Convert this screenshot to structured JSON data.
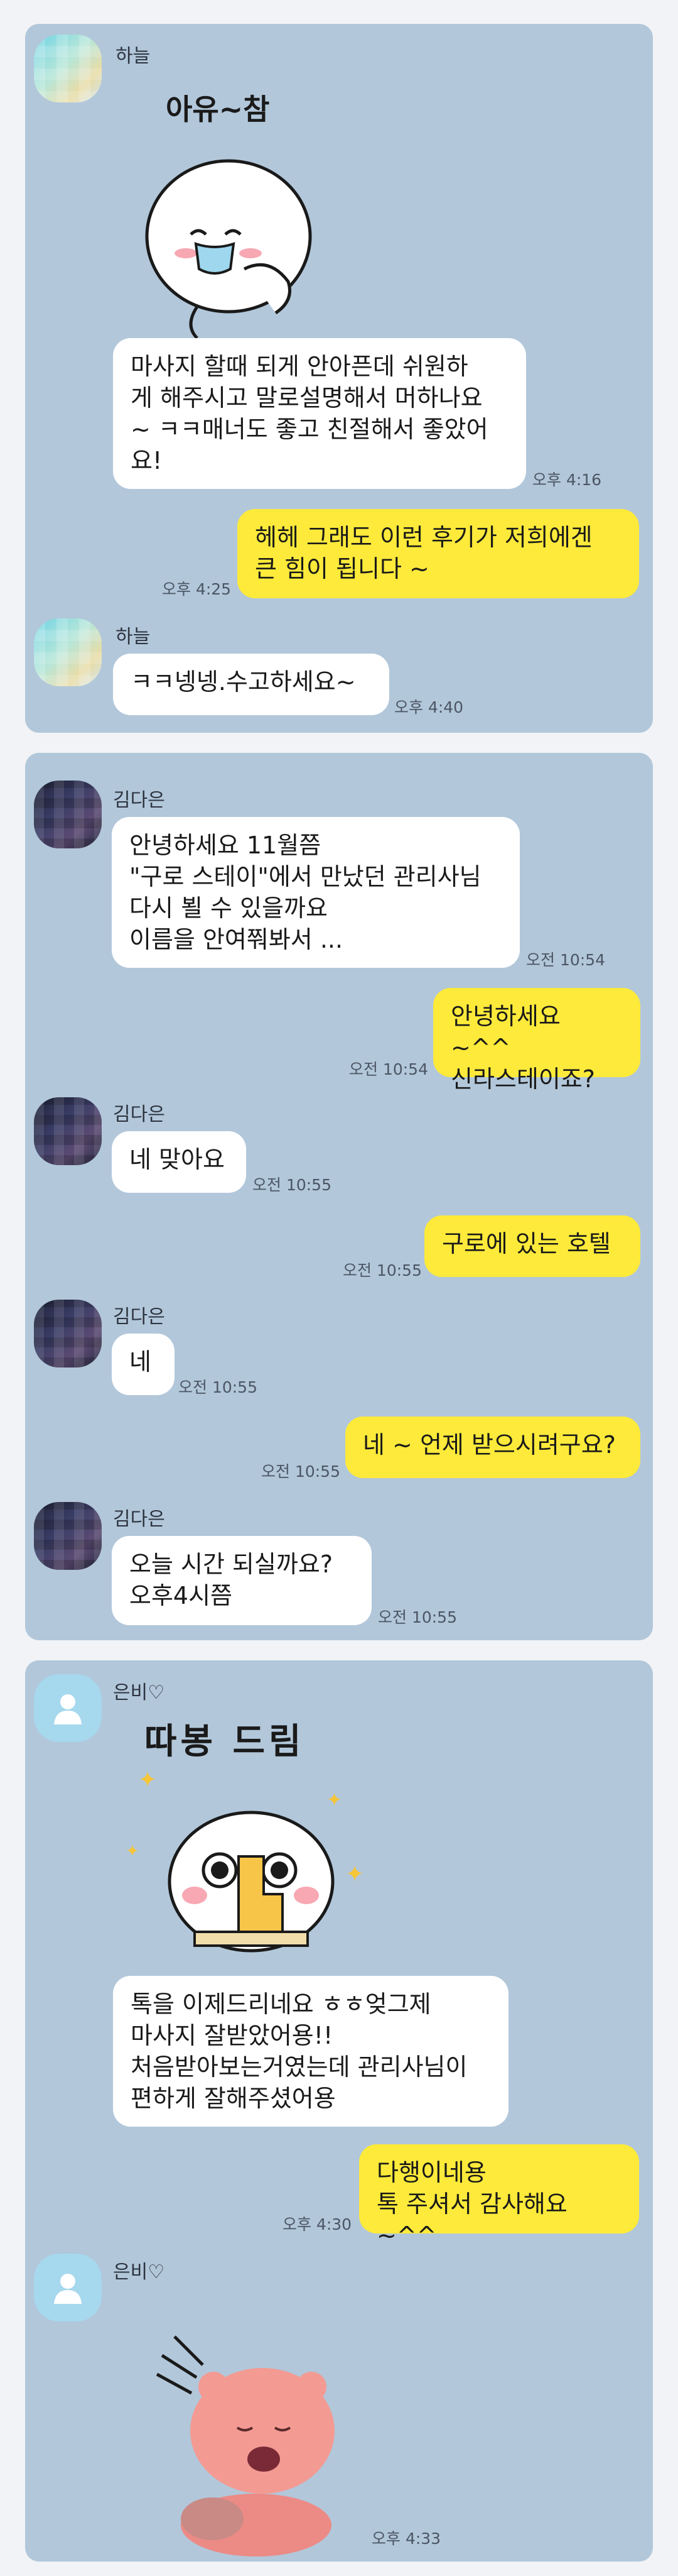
{
  "colors": {
    "chat_bg": "#b2c7da",
    "incoming_bubble": "#ffffff",
    "outgoing_bubble": "#fdea3a"
  },
  "chat1": {
    "sender": "하늘",
    "sticker_text": "아유~참",
    "msg1": "마사지 할때 되게 안아픈데 쉬원하\n게 해주시고 말로설명해서 머하나요\n~ ㅋㅋ매너도 좋고 친절해서 좋았어\n요!",
    "time1": "오후 4:16",
    "reply1": "헤헤 그래도 이런 후기가 저희에겐\n큰 힘이 됩니다 ~",
    "reply_time1": "오후 4:25",
    "msg2": "ㅋㅋ넹넹.수고하세요~",
    "time2": "오후 4:40"
  },
  "chat2": {
    "sender": "김다은",
    "msg1": "안녕하세요 11월쯤\n\"구로 스테이\"에서 만났던 관리사님\n다시 뵐 수 있을까요\n이름을 안여쭤봐서 ...",
    "time1": "오전 10:54",
    "reply1": "안녕하세요 ~^^\n신라스테이죠?",
    "reply_time1": "오전 10:54",
    "msg2": "네 맞아요",
    "time2": "오전 10:55",
    "reply2": "구로에 있는 호텔",
    "reply_time2": "오전 10:55",
    "msg3": "네",
    "time3": "오전 10:55",
    "reply3": "네 ~ 언제 받으시려구요?",
    "reply_time3": "오전 10:55",
    "msg4": "오늘  시간 되실까요?\n오후4시쯤",
    "time4": "오전 10:55"
  },
  "chat3": {
    "sender": "은비♡",
    "sticker_text": "따봉 드림",
    "msg1": "톡을 이제드리네요 ㅎㅎ엊그제\n마사지 잘받았어용!!\n처음받아보는거였는데 관리사님이\n편하게 잘해주셨어용",
    "reply1": "다행이네용\n톡 주셔서 감사해요 ~^^",
    "reply_time1": "오후 4:30",
    "time_last": "오후 4:33"
  }
}
